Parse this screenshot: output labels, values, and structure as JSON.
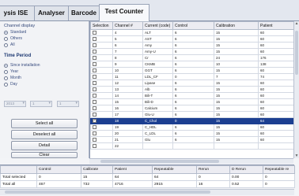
{
  "tabs": [
    {
      "label": "ysis ISE",
      "active": false
    },
    {
      "label": "Analyser",
      "active": false
    },
    {
      "label": "Barcode",
      "active": false
    },
    {
      "label": "Test Counter",
      "active": true
    }
  ],
  "left": {
    "channel_display_label": "Channel display",
    "channel_display_options": [
      "Standard",
      "Others",
      "All"
    ],
    "channel_display_selected": 0,
    "time_period_title": "Time Period",
    "time_period_options": [
      "Since installation",
      "Year",
      "Month",
      "Day"
    ],
    "time_period_selected": 0,
    "date_fields": [
      "2013",
      "1",
      "1"
    ],
    "buttons": [
      "Select all",
      "Deselect all",
      "Detail",
      "Clear"
    ]
  },
  "grid": {
    "columns": [
      "Selection",
      "Channel #",
      "Current (code)",
      "Control",
      "Calibration",
      "Patient"
    ],
    "rows": [
      {
        "checked": false,
        "channel": "4",
        "code": "ALT",
        "control": "6",
        "calibration": "15",
        "patient": "60"
      },
      {
        "checked": false,
        "channel": "5",
        "code": "AST",
        "control": "6",
        "calibration": "15",
        "patient": "60"
      },
      {
        "checked": false,
        "channel": "6",
        "code": "Amy",
        "control": "6",
        "calibration": "15",
        "patient": "60"
      },
      {
        "checked": false,
        "channel": "7",
        "code": "Amy-U",
        "control": "6",
        "calibration": "15",
        "patient": "60"
      },
      {
        "checked": false,
        "channel": "8",
        "code": "Cr",
        "control": "6",
        "calibration": "24",
        "patient": "176"
      },
      {
        "checked": false,
        "channel": "9",
        "code": "CKMB",
        "control": "6",
        "calibration": "10",
        "patient": "138"
      },
      {
        "checked": false,
        "channel": "10",
        "code": "GGT",
        "control": "6",
        "calibration": "15",
        "patient": "60"
      },
      {
        "checked": false,
        "channel": "11",
        "code": "LDL_CF",
        "control": "0",
        "calibration": "7",
        "patient": "74"
      },
      {
        "checked": false,
        "channel": "12",
        "code": "Lipase",
        "control": "6",
        "calibration": "15",
        "patient": "60"
      },
      {
        "checked": false,
        "channel": "13",
        "code": "Alb",
        "control": "6",
        "calibration": "15",
        "patient": "60"
      },
      {
        "checked": false,
        "channel": "14",
        "code": "Bili-T",
        "control": "6",
        "calibration": "15",
        "patient": "60"
      },
      {
        "checked": false,
        "channel": "15",
        "code": "Bili-D",
        "control": "6",
        "calibration": "15",
        "patient": "60"
      },
      {
        "checked": false,
        "channel": "16",
        "code": "Calcium",
        "control": "6",
        "calibration": "15",
        "patient": "60"
      },
      {
        "checked": false,
        "channel": "17",
        "code": "Glu-U",
        "control": "6",
        "calibration": "15",
        "patient": "60"
      },
      {
        "checked": true,
        "channel": "18",
        "code": "C_Chol",
        "control": "0",
        "calibration": "15",
        "patient": "64",
        "selected": true
      },
      {
        "checked": false,
        "channel": "19",
        "code": "C_HDL",
        "control": "6",
        "calibration": "15",
        "patient": "60"
      },
      {
        "checked": false,
        "channel": "20",
        "code": "C_LDL",
        "control": "6",
        "calibration": "15",
        "patient": "60"
      },
      {
        "checked": false,
        "channel": "21",
        "code": "Glu",
        "control": "6",
        "calibration": "15",
        "patient": "60"
      },
      {
        "checked": false,
        "channel": "22",
        "code": "",
        "control": "",
        "calibration": "",
        "patient": ""
      }
    ]
  },
  "summary": {
    "columns": [
      "",
      "Control",
      "Calibrate",
      "Patient",
      "Repeatable",
      "Rerun",
      "D Rerun",
      "Repeatable re"
    ],
    "rows": [
      [
        "Total selected",
        "0",
        "15",
        "64",
        "64",
        "0",
        "0.00",
        "0"
      ],
      [
        "Total all",
        "467",
        "732",
        "4716",
        "2915",
        "16",
        "0.52",
        "0"
      ]
    ]
  }
}
